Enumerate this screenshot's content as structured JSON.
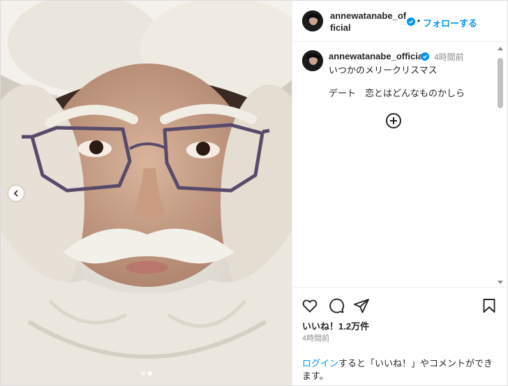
{
  "post": {
    "username": "annewatanabe_official",
    "header_username": "annewatanabe_of ficial",
    "separator": "•",
    "follow_label": "フォローする",
    "caption_time": "4時間前",
    "caption_line1": "いつかのメリークリスマス",
    "caption_line2": "デート　恋とはどんなものかしら",
    "likes": "いいね！1.2万件",
    "posted_time": "4時間前",
    "login_link": "ログイン",
    "login_rest": "すると「いいね！」やコメントができます。",
    "carousel": {
      "total": 2,
      "current": 2
    }
  },
  "colors": {
    "accent": "#0095f6",
    "text": "#262626",
    "muted": "#8e8e8e"
  },
  "icons": [
    "chevron-left-icon",
    "heart-icon",
    "comment-icon",
    "share-icon",
    "bookmark-icon",
    "verified-badge-icon",
    "add-circle-icon"
  ]
}
